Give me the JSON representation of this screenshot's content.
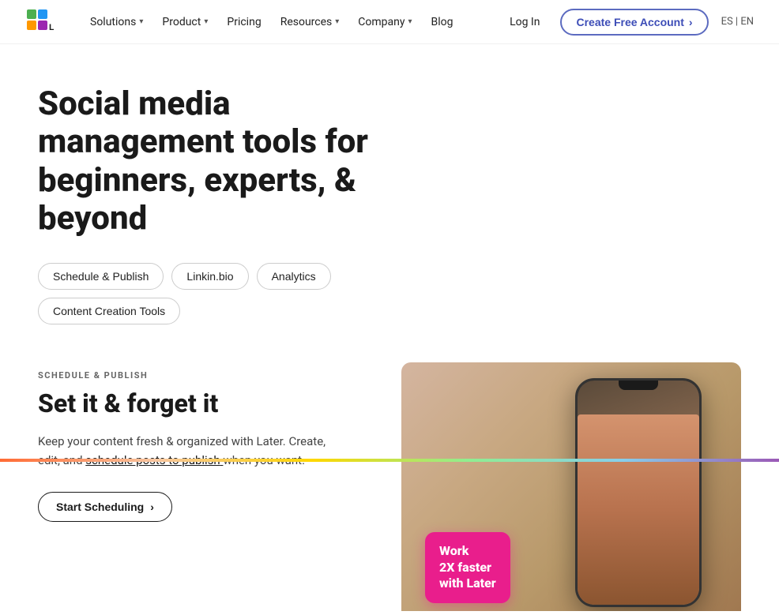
{
  "brand": {
    "name": "Later"
  },
  "navbar": {
    "links": [
      {
        "label": "Solutions",
        "has_dropdown": true
      },
      {
        "label": "Product",
        "has_dropdown": true
      },
      {
        "label": "Pricing",
        "has_dropdown": false
      },
      {
        "label": "Resources",
        "has_dropdown": true
      },
      {
        "label": "Company",
        "has_dropdown": true
      },
      {
        "label": "Blog",
        "has_dropdown": false
      }
    ],
    "login_label": "Log In",
    "cta_label": "Create Free Account",
    "lang_es": "ES",
    "lang_divider": "|",
    "lang_en": "EN"
  },
  "hero": {
    "title": "Social media management tools for beginners, experts, & beyond",
    "pills": [
      {
        "label": "Schedule & Publish"
      },
      {
        "label": "Linkin.bio"
      },
      {
        "label": "Analytics"
      },
      {
        "label": "Content Creation Tools"
      }
    ]
  },
  "section": {
    "label": "SCHEDULE & PUBLISH",
    "heading": "Set it & forget it",
    "body_prefix": "Keep your content fresh & organized with Later. Create, edit, and",
    "body_link": "schedule posts to publish",
    "body_suffix": " when you want.",
    "cta_label": "Start Scheduling",
    "cta_arrow": "›"
  },
  "badge": {
    "line1": "Work",
    "line2": "2X faster",
    "line3": "with Later"
  }
}
